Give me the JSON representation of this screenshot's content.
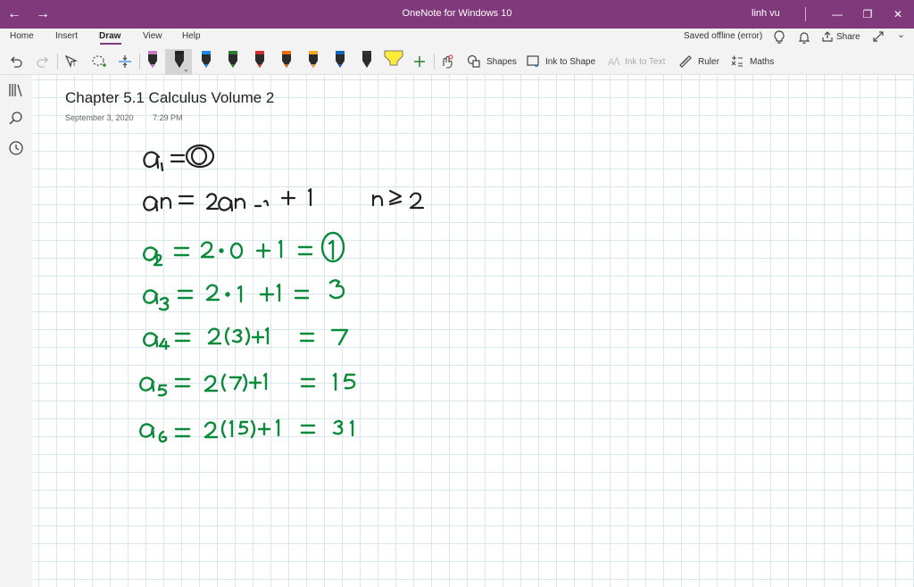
{
  "titlebar": {
    "app_title": "OneNote for Windows 10",
    "user": "linh vu",
    "back_icon": "arrow-left-icon",
    "forward_icon": "arrow-right-icon",
    "window_controls": [
      "minimize",
      "restore",
      "close"
    ]
  },
  "tabs": [
    {
      "label": "Home"
    },
    {
      "label": "Insert"
    },
    {
      "label": "Draw",
      "active": true
    },
    {
      "label": "View"
    },
    {
      "label": "Help"
    }
  ],
  "status": {
    "sync_text": "Saved offline (error)",
    "share_label": "Share"
  },
  "toolbar": {
    "shapes_label": "Shapes",
    "ink_to_shape_label": "Ink to Shape",
    "ink_to_text_label": "Ink to Text",
    "ruler_label": "Ruler",
    "maths_label": "Maths",
    "pen_colors": [
      "#c77bc0",
      "#222222",
      "#1e88e5",
      "#2e7d32",
      "#d32f2f",
      "#ef6c00",
      "#f9a825",
      "#1565c0",
      "#333333",
      "#ffeb3b"
    ],
    "accent": "#80397b"
  },
  "page": {
    "title": "Chapter 5.1 Calculus Volume 2",
    "date": "September 3, 2020",
    "time": "7:29 PM"
  },
  "ink_notes": {
    "line1": "a1 = 0",
    "line2": "an = 2an-1 + 1     n ≥ 2",
    "line3": "a2 = 2·0 + 1 = 1",
    "line4": "a3 = 2·1 + 1 = 3",
    "line5": "a4 = 2(3) + 1 = 7",
    "line6": "a5 = 2(7) + 1 = 15",
    "line7": "a6 = 2(15) + 1 = 31",
    "black_ink": "#222222",
    "green_ink": "#0b8a3a"
  }
}
